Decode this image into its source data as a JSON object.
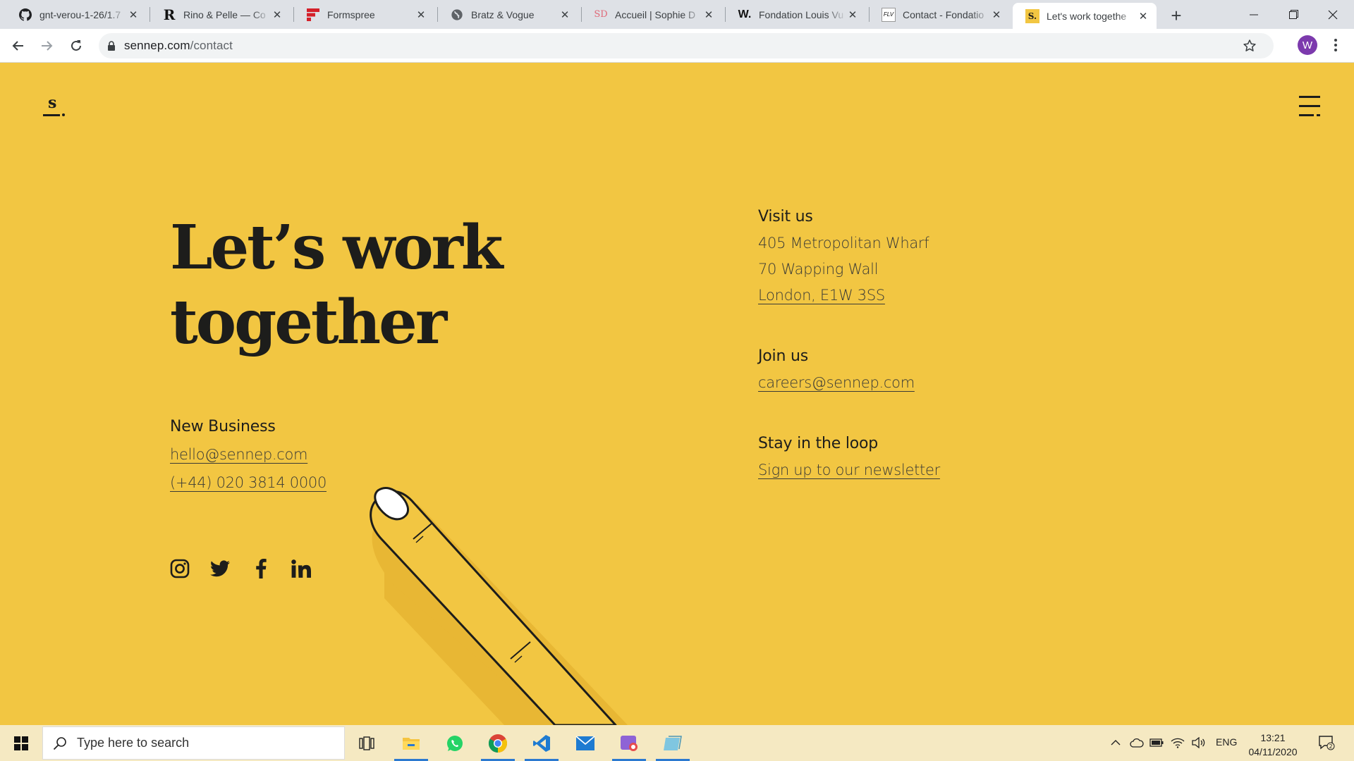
{
  "browser": {
    "tabs": [
      {
        "title": "gnt-verou-1-26/1.7",
        "icon": "github-icon"
      },
      {
        "title": "Rino & Pelle — Co",
        "icon": "rino-pelle-icon"
      },
      {
        "title": "Formspree",
        "icon": "formspree-icon"
      },
      {
        "title": "Bratz & Vogue",
        "icon": "globe-icon"
      },
      {
        "title": "Accueil | Sophie D",
        "icon": "sophie-icon"
      },
      {
        "title": "Fondation Louis Vu",
        "icon": "fondation-w-icon"
      },
      {
        "title": "Contact - Fondatio",
        "icon": "flv-icon"
      },
      {
        "title": "Let's work togethe",
        "icon": "sennep-icon",
        "active": true
      }
    ],
    "url_domain": "sennep.com",
    "url_path": "/contact",
    "profile_initial": "W",
    "favicon_labels": {
      "sophie": "SD",
      "fondation": "W.",
      "flv": "FLV",
      "sennep": "S.",
      "rino": "R"
    }
  },
  "site": {
    "logo_letter": "s",
    "heading_line1": "Let’s work",
    "heading_line2": "together",
    "new_business": {
      "title": "New Business",
      "email": "hello@sennep.com",
      "phone": "(+44) 020 3814 0000"
    },
    "visit": {
      "title": "Visit us",
      "line1": "405 Metropolitan Wharf",
      "line2": "70 Wapping Wall",
      "line3": "London, E1W 3SS"
    },
    "join": {
      "title": "Join us",
      "email": "careers@sennep.com"
    },
    "loop": {
      "title": "Stay in the loop",
      "link": "Sign up to our newsletter"
    },
    "social": [
      "instagram-icon",
      "twitter-icon",
      "facebook-icon",
      "linkedin-icon"
    ],
    "colors": {
      "background": "#f2c642",
      "ink": "#1d1d1b"
    }
  },
  "taskbar": {
    "search_placeholder": "Type here to search",
    "apps": [
      "task-view-icon",
      "file-explorer-icon",
      "whatsapp-icon",
      "chrome-icon",
      "vscode-icon",
      "mail-icon",
      "media-icon",
      "notes-icon"
    ],
    "language": "ENG",
    "time": "13:21",
    "date": "04/11/2020",
    "notifications": "2"
  }
}
